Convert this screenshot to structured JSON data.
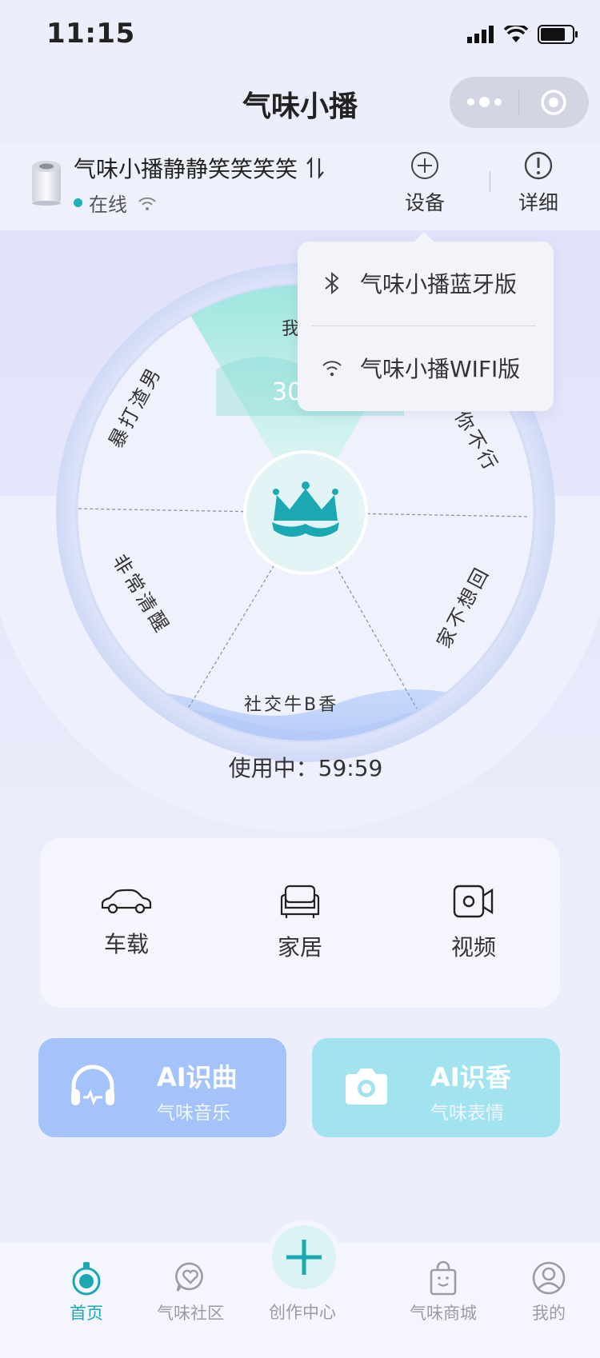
{
  "status_bar": {
    "time": "11:15"
  },
  "header": {
    "title": "气味小播"
  },
  "device": {
    "name": "气味小播静静笑笑笑笑",
    "status": "在线",
    "add_label": "设备",
    "detail_label": "详细"
  },
  "dropdown": {
    "items": [
      {
        "icon": "bluetooth-icon",
        "label": "气味小播蓝牙版"
      },
      {
        "icon": "wifi-icon",
        "label": "气味小播WIFI版"
      }
    ]
  },
  "wheel": {
    "segments": [
      "我想",
      "你不行",
      "家不想回",
      "社交牛B香",
      "非常清醒",
      "暴打渣男"
    ],
    "active_value": "30",
    "usage_label": "使用中：59:59"
  },
  "scenes": [
    {
      "icon": "car-icon",
      "label": "车载"
    },
    {
      "icon": "sofa-icon",
      "label": "家居"
    },
    {
      "icon": "video-camera-icon",
      "label": "视频"
    }
  ],
  "ai_cards": [
    {
      "title": "AI识曲",
      "subtitle": "气味音乐",
      "icon": "headphones-icon",
      "color": "#a3c3fa"
    },
    {
      "title": "AI识香",
      "subtitle": "气味表情",
      "icon": "camera-icon",
      "color": "#a1e3ef"
    }
  ],
  "tabs": [
    {
      "label": "首页",
      "icon": "home-perfume-icon",
      "active": true
    },
    {
      "label": "气味社区",
      "icon": "heart-chat-icon",
      "active": false
    },
    {
      "label": "创作中心",
      "icon": "plus-icon",
      "active": false
    },
    {
      "label": "气味商城",
      "icon": "shopping-bag-icon",
      "active": false
    },
    {
      "label": "我的",
      "icon": "user-icon",
      "active": false
    }
  ],
  "colors": {
    "accent": "#1aa8b3",
    "ai_blue": "#a3c3fa",
    "ai_cyan": "#a1e3ef"
  }
}
